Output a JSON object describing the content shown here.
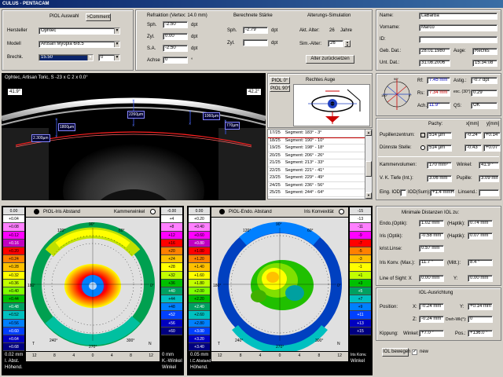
{
  "window": {
    "title": "CULUS - PENTACAM"
  },
  "piol": {
    "group_label": "PIOL Auswahl",
    "comment_button": ">Comment",
    "hersteller_label": "Hersteller",
    "hersteller_value": "Ophtec",
    "modell_label": "Modell",
    "modell_value": "Artisan Myopia 6/8.5",
    "brechk_label": "Brechk.",
    "brechk_value": "15.50",
    "brechk_unit_value": "0"
  },
  "refraction": {
    "title": "Refraktion (Vertex: 14.0 mm)",
    "sph_label": "Sph.",
    "sph_value": "-2.50",
    "sph_unit": "dpt",
    "zyl_label": "Zyl.",
    "zyl_value": "0.00",
    "zyl_unit": "dpt",
    "sa_label": "S.A.",
    "sa_value": "-2.50",
    "sa_unit": "dpt",
    "achse_label": "Achse",
    "achse_value": "0",
    "achse_unit": "°"
  },
  "calc": {
    "title": "Berechnete Stärke",
    "sph_label": "Sph.",
    "sph_value": "-2.79",
    "sph_unit": "dpt",
    "zyl_label": "Zyl.",
    "zyl_value": "",
    "zyl_unit": "dpt"
  },
  "aging": {
    "title": "Alterungs-Simulation",
    "akt_label": "Akt. Alter:",
    "akt_value": "26",
    "akt_unit": "Jahre",
    "sim_label": "Sim.-Alter:",
    "sim_value": "26",
    "reset_button": "Alter zurücksetzen"
  },
  "patient": {
    "name_label": "Name:",
    "name_value": "LaBarba",
    "vorname_label": "Vorname:",
    "vorname_value": "Marco",
    "id_label": "ID:",
    "id_value": "",
    "geb_label": "Geb. Dat.:",
    "geb_value": "28.01.1980",
    "auge_label": "Auge:",
    "auge_value": "Rechts",
    "unt_label": "Unt. Dat.:",
    "unt_value": "31.08.2006",
    "time_value": "15:34:08"
  },
  "scheimpflug": {
    "caption": "Ophtec, Artisan Toric, S -23 x C 2 x 0.0°",
    "left_angle": "41.9°",
    "right_angle": "42.2°",
    "meas_1": "2.300µm",
    "meas_2": "1800µm",
    "meas_3": "2260µm",
    "meas_4": "1060µm",
    "meas_5": "770µm"
  },
  "eye_diagram": {
    "piol0": "PIOL 0°",
    "piol90": "PIOL 90°",
    "title": "Rechtes Auge"
  },
  "segments": [
    {
      "frac": "17/25",
      "label": "Segment: 183° - 3°"
    },
    {
      "frac": "18/25",
      "label": "Segment: 190° - 10°"
    },
    {
      "frac": "19/25",
      "label": "Segment: 198° - 18°"
    },
    {
      "frac": "20/25",
      "label": "Segment: 206° - 26°"
    },
    {
      "frac": "21/25",
      "label": "Segment: 213° - 33°"
    },
    {
      "frac": "22/25",
      "label": "Segment: 221° - 41°"
    },
    {
      "frac": "23/25",
      "label": "Segment: 229° - 49°"
    },
    {
      "frac": "24/25",
      "label": "Segment: 236° - 56°"
    },
    {
      "frac": "25/25",
      "label": "Segment: 244° - 64°"
    }
  ],
  "kerato": {
    "rf_label": "Rf:",
    "rf_value": "7.45 mm",
    "astig_label": "Astig.:",
    "astig_value": "-0.7 dpt",
    "rs_label": "Rs:",
    "rs_value": "7.34 mm",
    "exc_label": "exc. (30°):",
    "exc_value": "0.29",
    "ach_label": "Ach.:",
    "ach_value": "11.9°",
    "qs_label": "QS:",
    "qs_value": "OK"
  },
  "pachy": {
    "pachy_header": "Pachy:",
    "x_header": "x[mm]",
    "y_header": "y[mm]",
    "pup_label": "Pupillenzentrum:",
    "pup_value": "514 µm",
    "pup_x": "-0.24",
    "pup_y": "+0.14",
    "thin_label": "Dünnste Stelle:",
    "thin_value": "514 µm",
    "thin_x": "-0.43",
    "thin_y": "+0.07",
    "kv_label": "Kammervolumen:",
    "kv_value": "170 mm³",
    "winkel_label": "Winkel:",
    "winkel_value": "41.9 °",
    "vk_label": "V. K. Tiefe (Int.):",
    "vk_value": "3.06 mm",
    "pupille_label": "Pupille:",
    "pupille_value": "3.09 mm",
    "iop_label": "Eing. IOD:",
    "iop_sum_label": "IOD(Sum):",
    "iop_value": "+1.4 mmHg",
    "linsend_label": "Linsend.:",
    "linsend_value": ""
  },
  "left_map": {
    "radio_label": "PIOL-Iris Abstand",
    "right_label": "Kammerwinkel",
    "scale_left": [
      "0.00",
      "+0.04",
      "+0.08",
      "+0.12",
      "+0.16",
      "+0.20",
      "+0.24",
      "+0.28",
      "+0.32",
      "+0.36",
      "+0.40",
      "+0.44",
      "+0.48",
      "+0.52",
      "+0.56",
      "+0.60",
      "+0.64",
      "+0.68"
    ],
    "scale_right": [
      "-0.00",
      "+4",
      "+8",
      "+12",
      "+16",
      "+20",
      "+24",
      "+28",
      "+32",
      "+36",
      "+40",
      "+44",
      "+48",
      "+52",
      "+56",
      "+60"
    ],
    "bottom_left_1": "0.02 mm",
    "bottom_left_2": "I. Abst.",
    "bottom_left_3": "Höhend.",
    "bottom_right_1": "0 mm",
    "bottom_right_2": "K.-Winkel",
    "bottom_right_3": "Winkel",
    "axis_ticks": [
      "12",
      "8",
      "4",
      "0",
      "4",
      "8",
      "12"
    ]
  },
  "right_map": {
    "radio_label": "PIOL-Endo. Abstand",
    "right_label": "Iris Konvexität",
    "scale_left": [
      "0.00",
      "+0.20",
      "+0.40",
      "+0.60",
      "+0.80",
      "+1.00",
      "+1.20",
      "+1.40",
      "+1.60",
      "+1.80",
      "+2.00",
      "+2.20",
      "+2.40",
      "+2.60",
      "+2.80",
      "+3.00",
      "+3.20",
      "+3.40"
    ],
    "scale_right": [
      "-15",
      "-13",
      "-11",
      "-9",
      "-7",
      "-5",
      "-3",
      "-1",
      "+1",
      "+3",
      "+5",
      "+7",
      "+9",
      "+11",
      "+13",
      "+15"
    ],
    "bottom_left_1": "0.05 mm",
    "bottom_left_2": "I.C.Abstand",
    "bottom_left_3": "Höhend.",
    "bottom_right_1": "Iris Konv.",
    "bottom_right_2": "Winkel",
    "axis_ticks": [
      "12",
      "8",
      "4",
      "0",
      "4",
      "8",
      "12"
    ]
  },
  "min_dist": {
    "title": "Minimale Distanzen IOL zu:",
    "endo_label": "Endo.(Optik):",
    "endo_value": "1.02 mm",
    "haptik_label": "(Haptik):",
    "endo_haptik": "0.74 mm",
    "iris_label": "Iris (Optik):",
    "iris_value": "-0.58 mm",
    "iris_haptik": "0.07 mm",
    "krist_label": "krist.Linse:",
    "krist_value": "0.57 mm",
    "konv_label": "Iris Konv. (Max.):",
    "konv_value": "11.7 °",
    "mitt_label": "(Mitt.):",
    "konv_mitt": "8.4 °",
    "los_label": "Line of Sight: X",
    "los_x": "0.00 mm",
    "los_y_label": "Y:",
    "los_y": "0.00 mm"
  },
  "iol_align": {
    "title": "IOL-Ausrichtung",
    "pos_label": "Position:",
    "x_label": "X:",
    "x_value": "-0.24 mm",
    "y_label": "Y:",
    "y_value": "+0.14 mm",
    "z_label": "Z:",
    "z_value": "-0.24 mm",
    "dreh_label": "Dreh-Wk(°):",
    "dreh_value": "0",
    "kipp_label": "Kippung:",
    "winkel_label": "Winkel:",
    "winkel_value": "+7.0 °",
    "pos2_label": "Pos.:",
    "pos2_value": "+136.0 °",
    "move_button": "IOL bewegen",
    "new_label": "new"
  },
  "colors": {
    "accent_red": "#ff0000",
    "accent_blue": "#0000c0",
    "title_blue": "#0a246a"
  }
}
